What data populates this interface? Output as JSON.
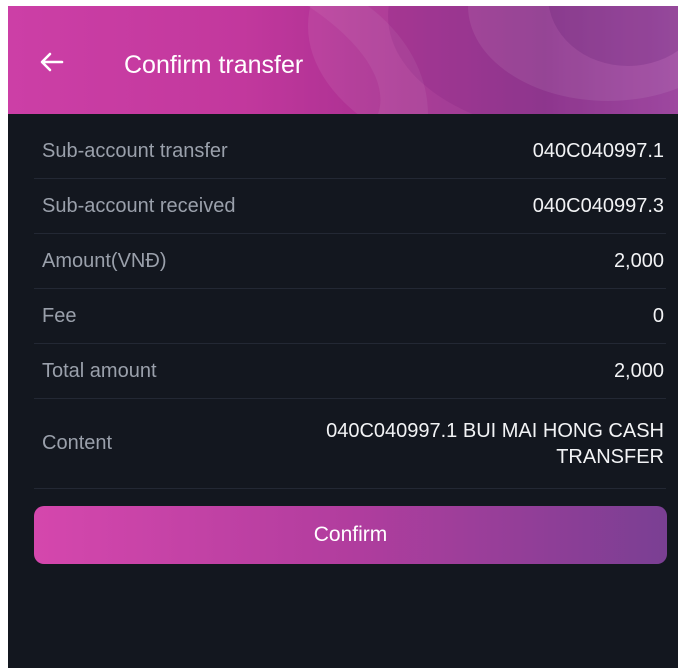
{
  "colors": {
    "background": "#13171f",
    "header_start": "#cc3fa6",
    "header_end": "#8a2f8a",
    "label": "#9aa0ab",
    "value": "#f2f3f5",
    "divider": "#232834",
    "button_start": "#d547ad",
    "button_end": "#7a3f93"
  },
  "header": {
    "back_icon": "arrow-left-icon",
    "title": "Confirm transfer"
  },
  "details": {
    "sub_account_transfer": {
      "label": "Sub-account transfer",
      "value": "040C040997.1"
    },
    "sub_account_received": {
      "label": "Sub-account received",
      "value": "040C040997.3"
    },
    "amount": {
      "label": "Amount(VNĐ)",
      "value": "2,000"
    },
    "fee": {
      "label": "Fee",
      "value": "0"
    },
    "total_amount": {
      "label": "Total amount",
      "value": "2,000"
    },
    "content": {
      "label": "Content",
      "value": "040C040997.1 BUI MAI HONG CASH TRANSFER"
    }
  },
  "actions": {
    "confirm_label": "Confirm"
  }
}
